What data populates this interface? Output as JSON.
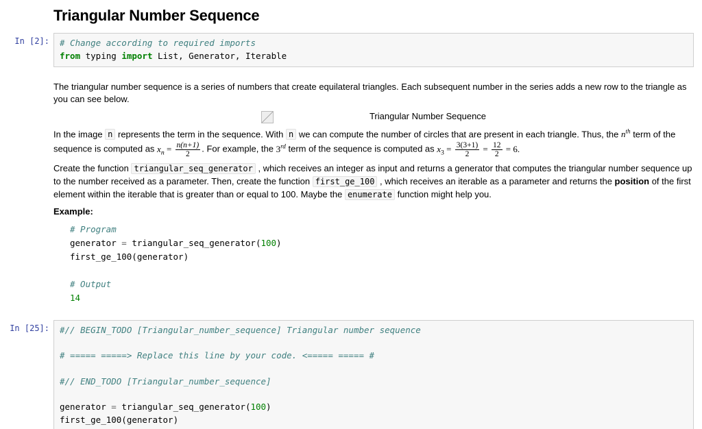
{
  "header": {
    "title": "Triangular Number Sequence"
  },
  "cell1": {
    "prompt": "In [2]:",
    "line1_comment": "# Change according to required imports",
    "line2_from": "from",
    "line2_mod": " typing ",
    "line2_import": "import",
    "line2_rest": " List, Generator, Iterable"
  },
  "md": {
    "p1": "The triangular number sequence is a series of numbers that create equilateral triangles. Each subsequent number in the series adds a new row to the triangle as you can see below.",
    "fig_caption": "Triangular Number Sequence",
    "p2a": "In the image ",
    "code_n1": "n",
    "p2b": " represents the term in the sequence. With ",
    "code_n2": "n",
    "p2c": " we can compute the number of circles that are present in each triangle. Thus, the ",
    "nth_base": "n",
    "nth_sup": "th",
    "p2d": " term of the sequence is computed as ",
    "eq1_lhs_x": "x",
    "eq1_lhs_sub": "n",
    "eq1_eq": " = ",
    "eq1_num": "n(n+1)",
    "eq1_den": "2",
    "p2e": ". For example, the ",
    "third_base": "3",
    "third_sup": "rd",
    "p2f": " term of the sequence is computed as ",
    "eq2_lhs_x": "x",
    "eq2_lhs_sub": "3",
    "eq2_eq": " = ",
    "eq2_num": "3(3+1)",
    "eq2_den": "2",
    "eq2_eq2": " = ",
    "eq2b_num": "12",
    "eq2b_den": "2",
    "eq2_res": " = 6.",
    "p3a": "Create the function ",
    "code_fn1": "triangular_seq_generator",
    "p3b": " , which receives an integer as input and returns a generator that computes the triangular number sequence up to the number received as a parameter. Then, create the function ",
    "code_fn2": "first_ge_100",
    "p3c": " , which receives an iterable as a parameter and returns the ",
    "position": "position",
    "p3d": " of the first element within the iterable that is greater than or equal to 100. Maybe the ",
    "code_enum": "enumerate",
    "p3e": " function might help you.",
    "example_label": "Example:",
    "ex_c1": "# Program",
    "ex_l1a": "generator ",
    "ex_l1op": "=",
    "ex_l1b": " triangular_seq_generator(",
    "ex_l1num": "100",
    "ex_l1c": ")",
    "ex_l2": "first_ge_100(generator)",
    "ex_c2": "# Output",
    "ex_out": "14"
  },
  "cell2": {
    "prompt": "In [25]:",
    "l1": "#// BEGIN_TODO [Triangular_number_sequence] Triangular number sequence",
    "l2": "# ===== =====> Replace this line by your code. <===== ===== #",
    "l3": "#// END_TODO [Triangular_number_sequence]",
    "l4a": "generator ",
    "l4op": "=",
    "l4b": " triangular_seq_generator(",
    "l4num": "100",
    "l4c": ")",
    "l5": "first_ge_100(generator)"
  }
}
